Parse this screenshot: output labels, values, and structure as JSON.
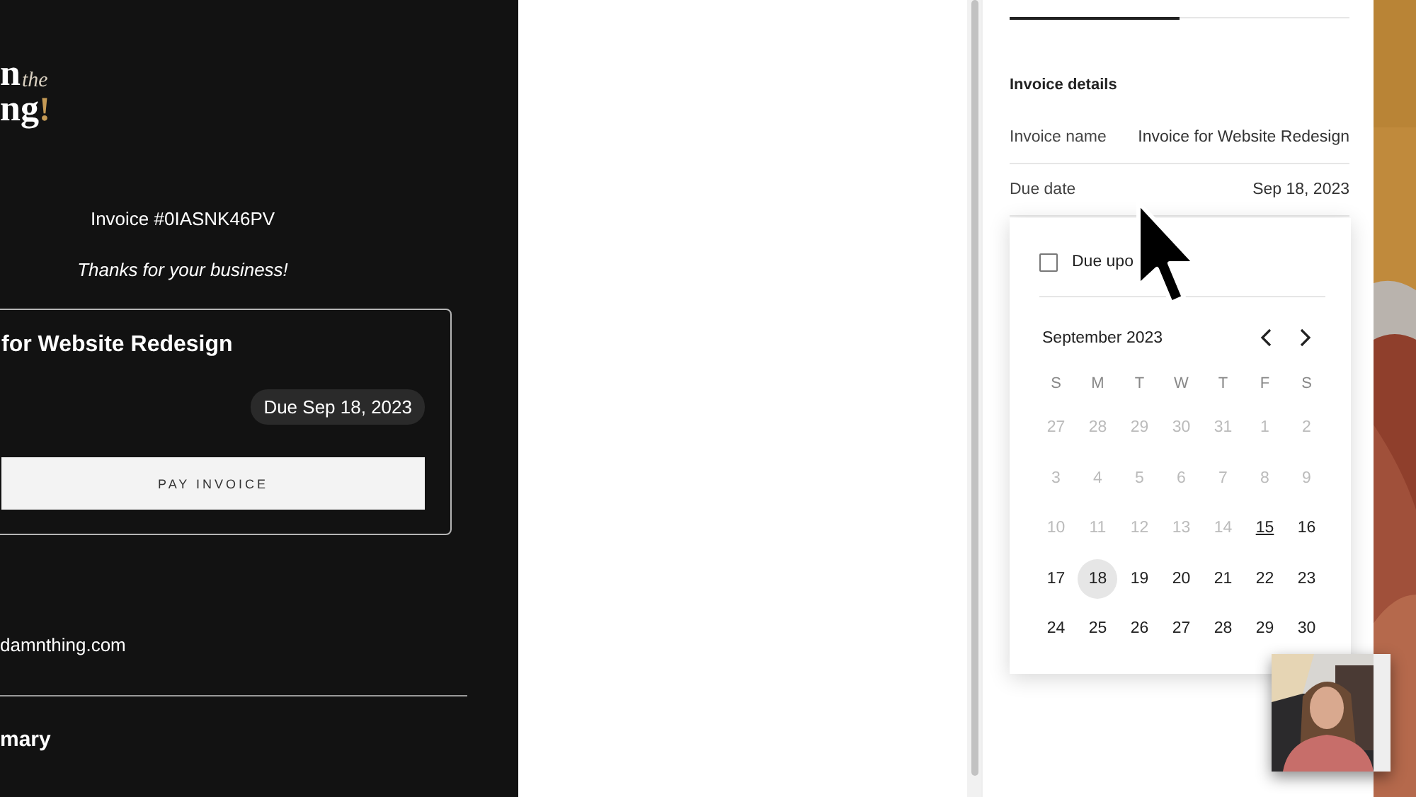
{
  "invoice_preview": {
    "logo": {
      "text_1": "n",
      "script": "the",
      "text_2": "ng",
      "mark": "!"
    },
    "invoice_number": "Invoice #0IASNK46PV",
    "message": "Thanks for your business!",
    "card": {
      "title": "for Website Redesign",
      "due_badge": "Due Sep 18, 2023",
      "pay_button": "PAY INVOICE"
    },
    "contact": "damnthing.com",
    "section_heading": "mary"
  },
  "details_panel": {
    "tabs": [
      {
        "selected": true
      },
      {
        "selected": false
      }
    ],
    "heading": "Invoice details",
    "fields": [
      {
        "label": "Invoice name",
        "value": "Invoice for Website Redesign"
      },
      {
        "label": "Due date",
        "value": "Sep 18, 2023"
      }
    ],
    "date_picker": {
      "due_upon_receipt": {
        "label": "Due upo",
        "checked": false
      },
      "month": "September 2023",
      "weekdays": [
        "S",
        "M",
        "T",
        "W",
        "T",
        "F",
        "S"
      ],
      "weeks": [
        [
          {
            "label": "27",
            "disabled": true,
            "today": false,
            "selected": false
          },
          {
            "label": "28",
            "disabled": true,
            "today": false,
            "selected": false
          },
          {
            "label": "29",
            "disabled": true,
            "today": false,
            "selected": false
          },
          {
            "label": "30",
            "disabled": true,
            "today": false,
            "selected": false
          },
          {
            "label": "31",
            "disabled": true,
            "today": false,
            "selected": false
          },
          {
            "label": "1",
            "disabled": true,
            "today": false,
            "selected": false
          },
          {
            "label": "2",
            "disabled": true,
            "today": false,
            "selected": false
          }
        ],
        [
          {
            "label": "3",
            "disabled": true,
            "today": false,
            "selected": false
          },
          {
            "label": "4",
            "disabled": true,
            "today": false,
            "selected": false
          },
          {
            "label": "5",
            "disabled": true,
            "today": false,
            "selected": false
          },
          {
            "label": "6",
            "disabled": true,
            "today": false,
            "selected": false
          },
          {
            "label": "7",
            "disabled": true,
            "today": false,
            "selected": false
          },
          {
            "label": "8",
            "disabled": true,
            "today": false,
            "selected": false
          },
          {
            "label": "9",
            "disabled": true,
            "today": false,
            "selected": false
          }
        ],
        [
          {
            "label": "10",
            "disabled": true,
            "today": false,
            "selected": false
          },
          {
            "label": "11",
            "disabled": true,
            "today": false,
            "selected": false
          },
          {
            "label": "12",
            "disabled": true,
            "today": false,
            "selected": false
          },
          {
            "label": "13",
            "disabled": true,
            "today": false,
            "selected": false
          },
          {
            "label": "14",
            "disabled": true,
            "today": false,
            "selected": false
          },
          {
            "label": "15",
            "disabled": false,
            "today": true,
            "selected": false
          },
          {
            "label": "16",
            "disabled": false,
            "today": false,
            "selected": false
          }
        ],
        [
          {
            "label": "17",
            "disabled": false,
            "today": false,
            "selected": false
          },
          {
            "label": "18",
            "disabled": false,
            "today": false,
            "selected": true
          },
          {
            "label": "19",
            "disabled": false,
            "today": false,
            "selected": false
          },
          {
            "label": "20",
            "disabled": false,
            "today": false,
            "selected": false
          },
          {
            "label": "21",
            "disabled": false,
            "today": false,
            "selected": false
          },
          {
            "label": "22",
            "disabled": false,
            "today": false,
            "selected": false
          },
          {
            "label": "23",
            "disabled": false,
            "today": false,
            "selected": false
          }
        ],
        [
          {
            "label": "24",
            "disabled": false,
            "today": false,
            "selected": false
          },
          {
            "label": "25",
            "disabled": false,
            "today": false,
            "selected": false
          },
          {
            "label": "26",
            "disabled": false,
            "today": false,
            "selected": false
          },
          {
            "label": "27",
            "disabled": false,
            "today": false,
            "selected": false
          },
          {
            "label": "28",
            "disabled": false,
            "today": false,
            "selected": false
          },
          {
            "label": "29",
            "disabled": false,
            "today": false,
            "selected": false
          },
          {
            "label": "30",
            "disabled": false,
            "today": false,
            "selected": false
          }
        ]
      ]
    }
  }
}
